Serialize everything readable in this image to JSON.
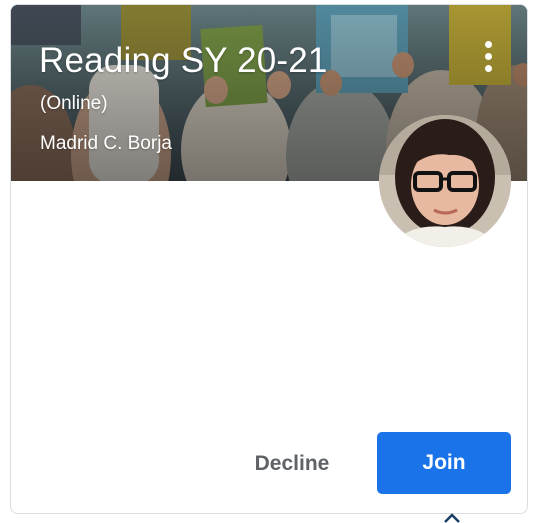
{
  "class_card": {
    "title": "Reading SY 20-21",
    "section": "(Online)",
    "teacher": "Madrid C. Borja",
    "banner_theme": "kids-reading-books",
    "menu_icon": "more-vert-icon",
    "avatar_icon": "teacher-avatar"
  },
  "actions": {
    "decline_label": "Decline",
    "join_label": "Join"
  },
  "colors": {
    "join_button": "#1a73e8",
    "decline_text": "#5f6368",
    "card_border": "#dadce0"
  }
}
